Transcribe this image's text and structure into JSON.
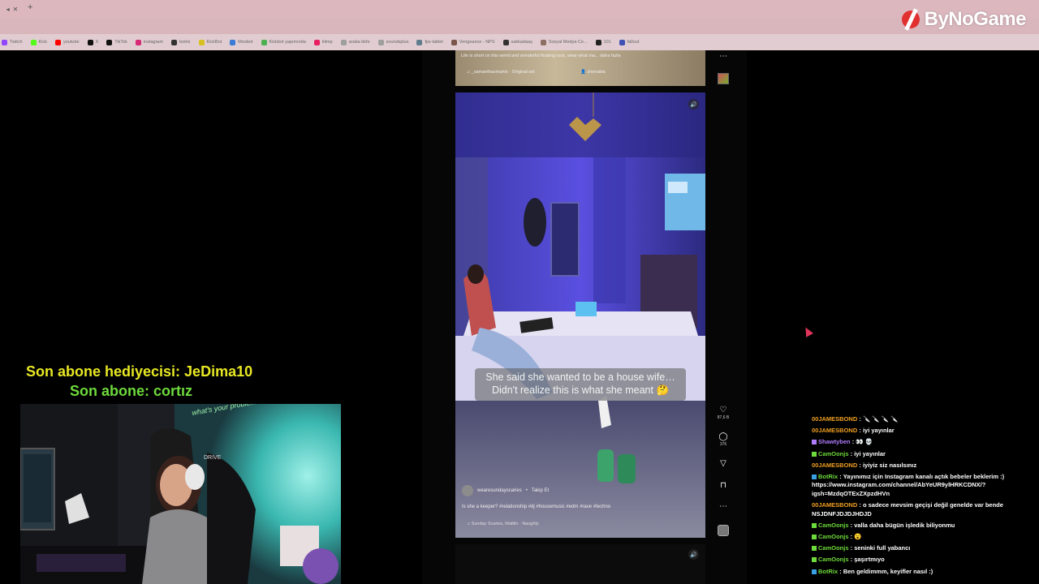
{
  "brand": {
    "name": "ByNoGame"
  },
  "bookmarks": [
    {
      "label": "Twitch",
      "color": "#9146ff"
    },
    {
      "label": "Kick",
      "color": "#53fc18"
    },
    {
      "label": "youtube",
      "color": "#ff0000"
    },
    {
      "label": "X",
      "color": "#111111"
    },
    {
      "label": "TikTok",
      "color": "#111111"
    },
    {
      "label": "instagram",
      "color": "#d62976"
    },
    {
      "label": "botrix",
      "color": "#333333"
    },
    {
      "label": "KickBot",
      "color": "#d8c020"
    },
    {
      "label": "Moobot",
      "color": "#3a7bd5"
    },
    {
      "label": "Kickbot yapımında",
      "color": "#4caf50"
    },
    {
      "label": "klimp",
      "color": "#e91e63"
    },
    {
      "label": "araba bkfe",
      "color": "#9e9e9e"
    },
    {
      "label": "soundsplus",
      "color": "#9e9e9e"
    },
    {
      "label": "fps tablet",
      "color": "#607d8b"
    },
    {
      "label": "Vengeance - NPS",
      "color": "#795548"
    },
    {
      "label": "sakkadaaş",
      "color": "#333333"
    },
    {
      "label": "Sosyal Medya Ce...",
      "color": "#8d6e63"
    },
    {
      "label": "101",
      "color": "#222222"
    },
    {
      "label": "fallout",
      "color": "#3f51b5"
    }
  ],
  "reel_top": {
    "caption": "Life is short on this weird and wonderful floating rock, wear what ma... daha fazla",
    "audio": "_samanthasmartin · Original set",
    "collab": "zhenabia"
  },
  "reel_main": {
    "subtitle_line1": "She said she wanted to be a house wife…",
    "subtitle_line2": "Didn't realize this is what she meant 🤔",
    "username": "wearesundayscaries",
    "follow": "Takip Et",
    "caption": "Is she a keeper? #relationship #dj #housemusic #edm #rave #techno",
    "audio": "Sunday Scaries, Mattilo · Naughty"
  },
  "actions": {
    "likes": "87,6 B",
    "comments": "376"
  },
  "overlay": {
    "sub_gifter": "Son abone hediyecisi: JeDima10",
    "last_sub": "Son abone: cortız"
  },
  "webcam": {
    "sign_text": "what's your problem?",
    "chair_brand": "DRIVE"
  },
  "chat": [
    {
      "user": "00JAMESBOND",
      "color": "#f0a020",
      "badge": "",
      "text": ": 🔪 🔪 🔪 🔪"
    },
    {
      "user": "00JAMESBOND",
      "color": "#f0a020",
      "badge": "",
      "text": ": iyi yayınlar"
    },
    {
      "user": "Shawtyben",
      "color": "#b07cff",
      "badge": "#b07cff",
      "text": ": 👀 💀"
    },
    {
      "user": "CamOonjs",
      "color": "#6edb3c",
      "badge": "#6edb3c",
      "text": ": iyi yayınlar"
    },
    {
      "user": "00JAMESBOND",
      "color": "#f0a020",
      "badge": "",
      "text": ": iyiyiz siz nasılsınız"
    },
    {
      "user": "BotRix",
      "color": "#6edb3c",
      "badge": "#3aa0e0",
      "text": ": Yayınımız için Instagram kanalı açtık bebeler beklerim :) https://www.instagram.com/channel/AbYeUR9ylHRKCDNX/?igsh=MzdqOTExZXpzdHVn"
    },
    {
      "user": "00JAMESBOND",
      "color": "#f0a020",
      "badge": "",
      "text": ": o sadece mevsim geçişi değil genelde var bende NSJDNFJDJDJHDJD"
    },
    {
      "user": "CamOonjs",
      "color": "#6edb3c",
      "badge": "#6edb3c",
      "text": ": valla daha bügün işledik biliyonmu"
    },
    {
      "user": "CamOonjs",
      "color": "#6edb3c",
      "badge": "#6edb3c",
      "text": ": 😮"
    },
    {
      "user": "CamOonjs",
      "color": "#6edb3c",
      "badge": "#6edb3c",
      "text": ": seninki full yabancı"
    },
    {
      "user": "CamOonjs",
      "color": "#6edb3c",
      "badge": "#6edb3c",
      "text": ": şaşırtmıyo"
    },
    {
      "user": "BotRix",
      "color": "#6edb3c",
      "badge": "#3aa0e0",
      "text": ": Ben geldimmm, keyifler nasıl :)"
    }
  ]
}
